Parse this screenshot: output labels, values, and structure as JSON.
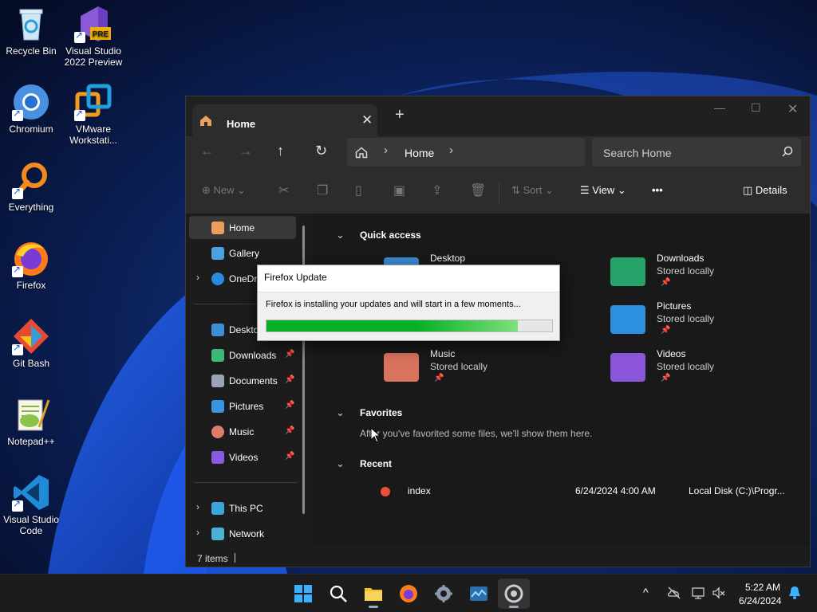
{
  "desktop": {
    "icons": [
      {
        "label": "Recycle Bin",
        "icon": "recycle-bin-icon"
      },
      {
        "label": "Visual Studio 2022 Preview",
        "icon": "visual-studio-preview-icon",
        "badge": "PRE"
      },
      {
        "label": "Chromium",
        "icon": "chromium-icon"
      },
      {
        "label": "VMware Workstati...",
        "icon": "vmware-icon"
      },
      {
        "label": "Everything",
        "icon": "everything-search-icon"
      },
      {
        "label": "Firefox",
        "icon": "firefox-icon"
      },
      {
        "label": "Git Bash",
        "icon": "git-bash-icon"
      },
      {
        "label": "Notepad++",
        "icon": "notepad-plus-plus-icon"
      },
      {
        "label": "Visual Studio Code",
        "icon": "vscode-icon"
      }
    ]
  },
  "explorer": {
    "tab_title": "Home",
    "tab_close": "✕",
    "new_tab": "+",
    "window_controls": {
      "minimize": "—",
      "maximize": "☐",
      "close": "✕"
    },
    "nav": {
      "back": "←",
      "forward": "→",
      "up": "↑",
      "refresh": "↻"
    },
    "address": {
      "location": "Home",
      "chevron": "›"
    },
    "search_placeholder": "Search Home",
    "commands": {
      "new": "New",
      "sort": "Sort",
      "view": "View",
      "more": "•••",
      "details": "Details"
    },
    "sidebar": {
      "items": [
        {
          "label": "Home",
          "icon": "home-icon",
          "color": "#e8a05c"
        },
        {
          "label": "Gallery",
          "icon": "gallery-icon",
          "color": "#4aa3df"
        },
        {
          "label": "OneDr",
          "icon": "onedrive-icon",
          "color": "#2a8ae0",
          "expander": "›"
        },
        {
          "label": "Deskto",
          "icon": "desktop-icon",
          "color": "#3a8fd6"
        },
        {
          "label": "Downloads",
          "icon": "downloads-icon",
          "color": "#3cb878",
          "pin": "📌"
        },
        {
          "label": "Documents",
          "icon": "documents-icon",
          "color": "#9aa4b0",
          "pin": "📌"
        },
        {
          "label": "Pictures",
          "icon": "pictures-icon",
          "color": "#3a95e0",
          "pin": "📌"
        },
        {
          "label": "Music",
          "icon": "music-icon",
          "color": "#e07a6a",
          "pin": "📌"
        },
        {
          "label": "Videos",
          "icon": "videos-icon",
          "color": "#8a5ae0",
          "pin": "📌"
        },
        {
          "label": "This PC",
          "icon": "this-pc-icon",
          "color": "#3aa7d6",
          "expander": "›"
        },
        {
          "label": "Network",
          "icon": "network-icon",
          "color": "#4ab0d6",
          "expander": "›"
        }
      ]
    },
    "quick_access": {
      "title": "Quick access",
      "folders": [
        {
          "name": "Desktop",
          "sub": "",
          "icon": "desktop-folder-icon",
          "color": "#3a8fd6"
        },
        {
          "name": "Downloads",
          "sub": "Stored locally",
          "icon": "downloads-folder-icon",
          "color": "#27a36a"
        },
        {
          "name": "Pictures",
          "sub": "Stored locally",
          "icon": "pictures-folder-icon",
          "color": "#2d8fe0"
        },
        {
          "name": "Music",
          "sub": "Stored locally",
          "icon": "music-folder-icon",
          "color": "#d9735e"
        },
        {
          "name": "Videos",
          "sub": "Stored locally",
          "icon": "videos-folder-icon",
          "color": "#8a55d8"
        }
      ]
    },
    "favorites": {
      "title": "Favorites",
      "message": "After you've favorited some files, we'll show them here."
    },
    "recent": {
      "title": "Recent",
      "items": [
        {
          "name": "index",
          "date": "6/24/2024 4:00 AM",
          "location": "Local Disk (C:)\\Progr..."
        }
      ]
    },
    "status": {
      "item_count": "7 items"
    }
  },
  "update_dialog": {
    "title": "Firefox Update",
    "message": "Firefox is installing your updates and will start in a few moments...",
    "progress": 0.88
  },
  "taskbar": {
    "apps": [
      "start-icon",
      "search-icon",
      "file-explorer-icon",
      "firefox-icon",
      "settings-icon",
      "task-manager-icon",
      "firefox-updater-icon"
    ],
    "tray_chevron": "^",
    "clock_time": "5:22 AM",
    "clock_date": "6/24/2024"
  }
}
